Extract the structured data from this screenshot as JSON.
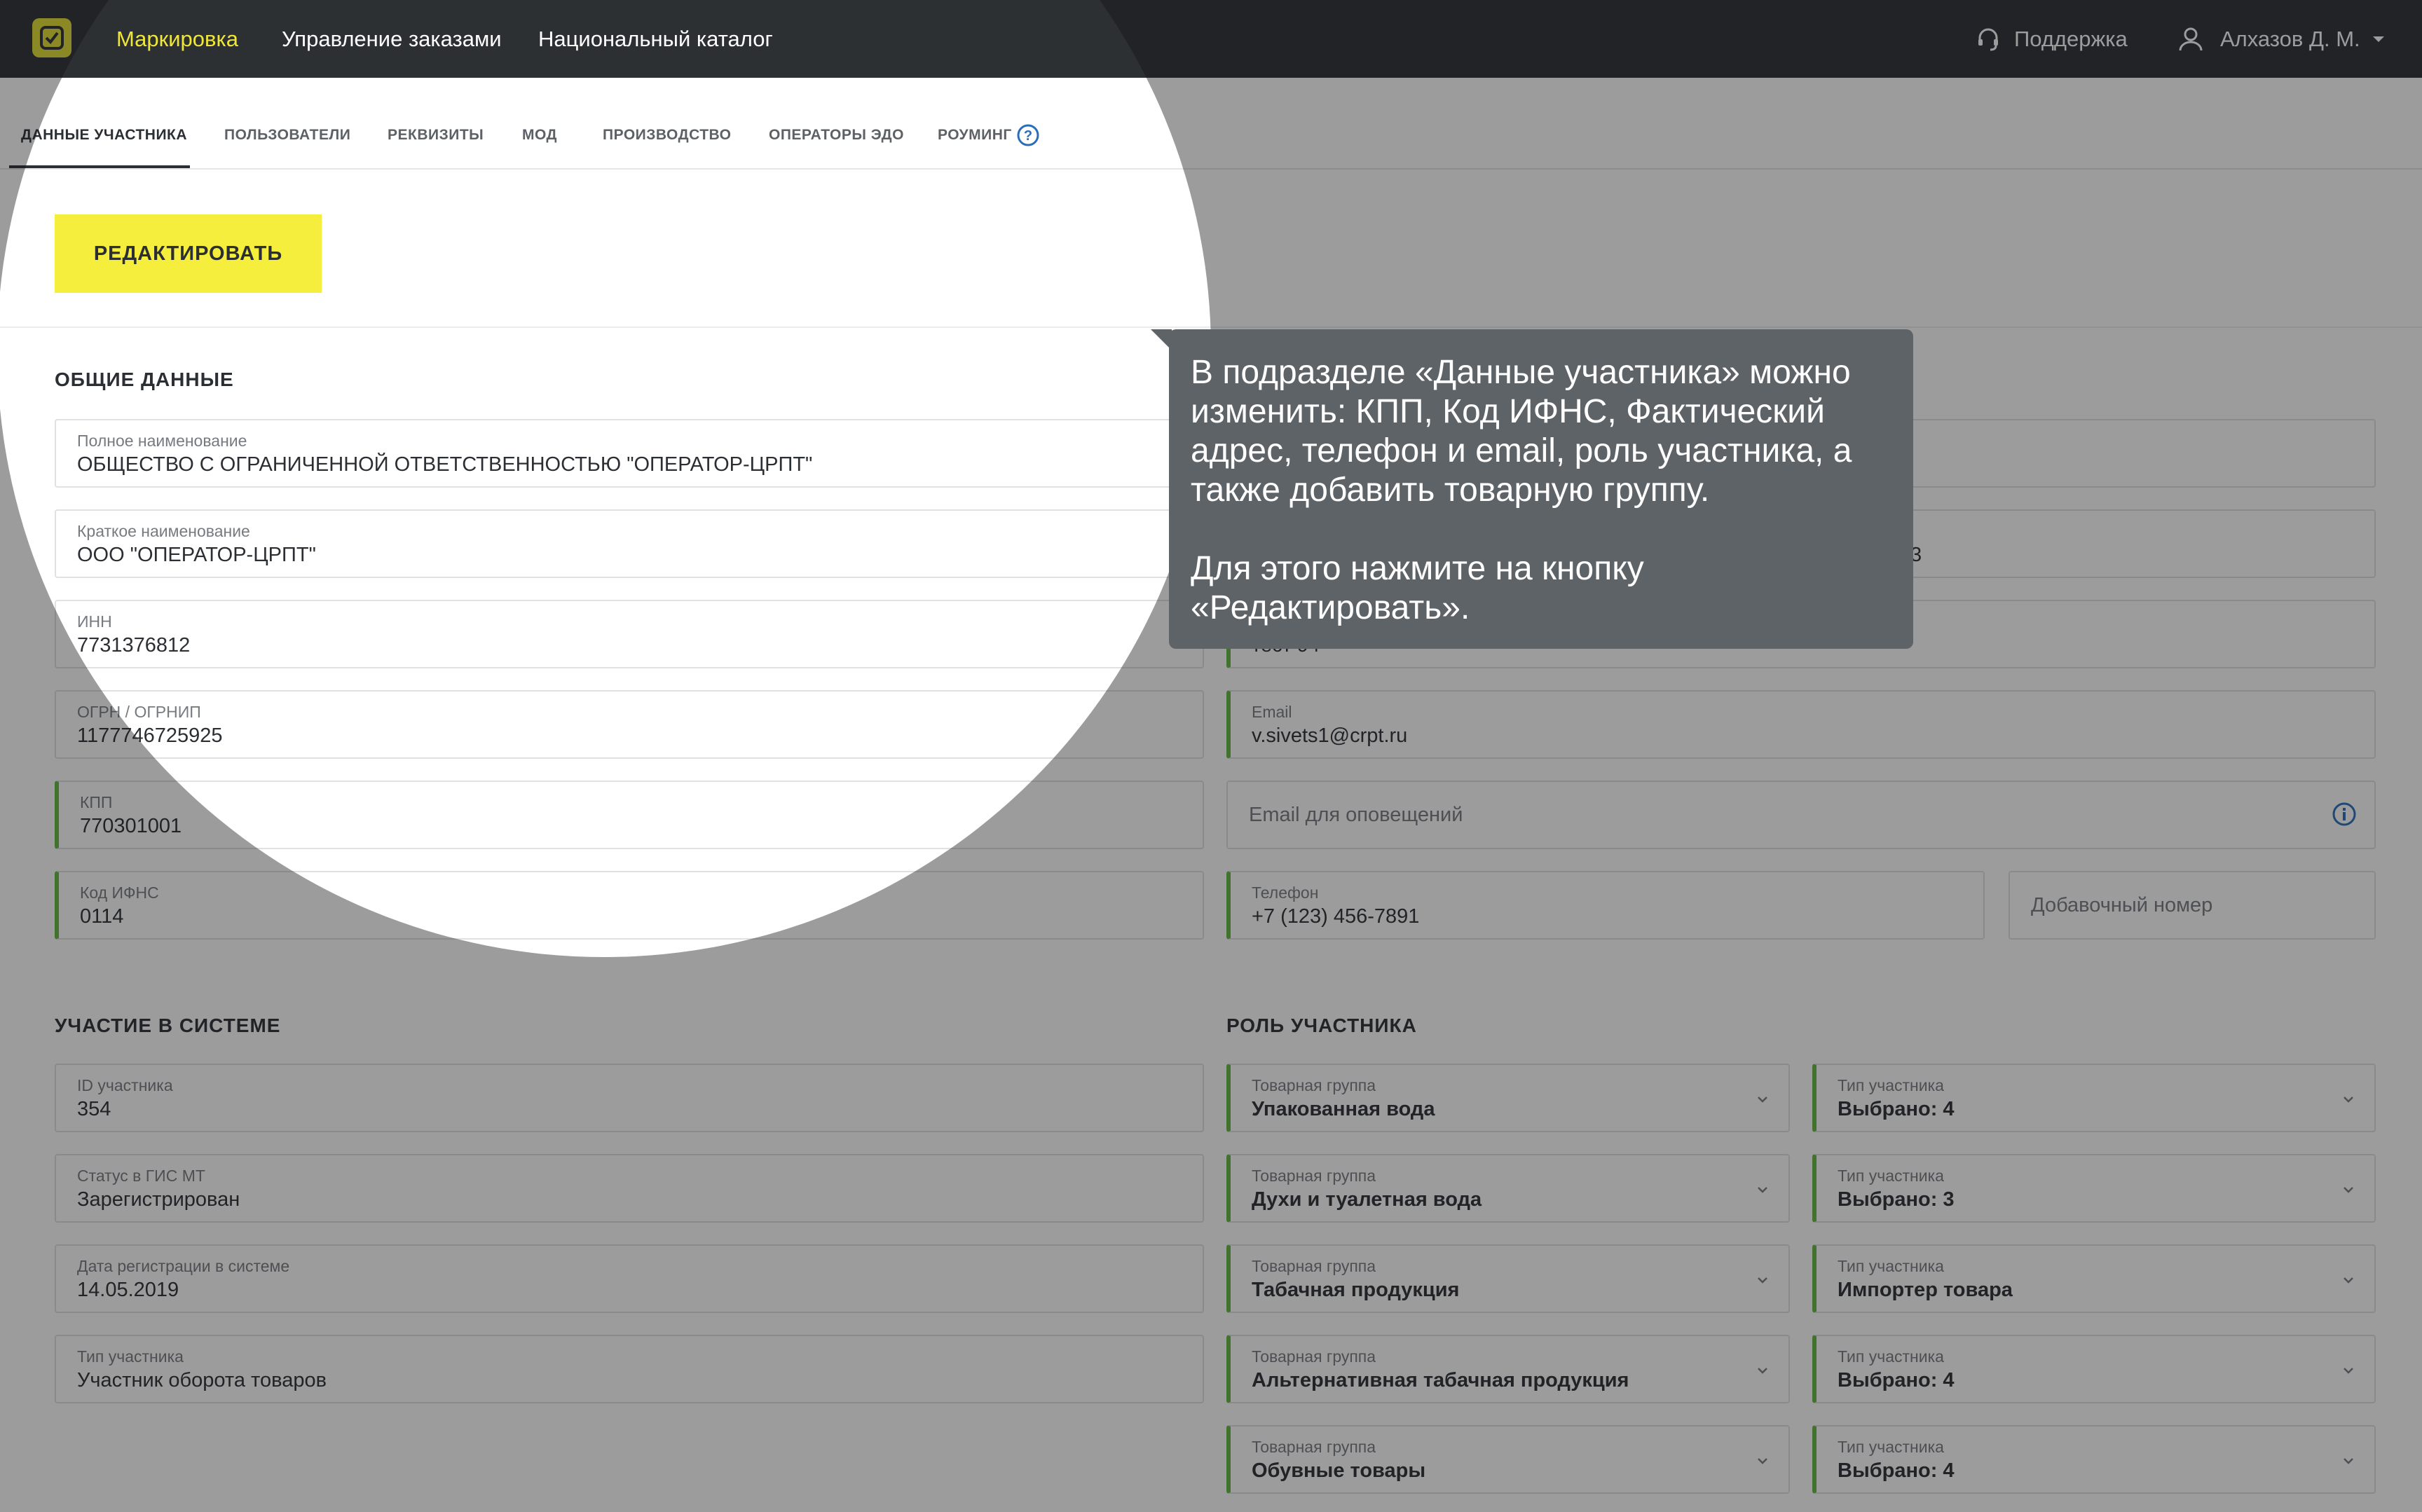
{
  "topnav": {
    "items": [
      "Маркировка",
      "Управление заказами",
      "Национальный каталог"
    ],
    "support": "Поддержка",
    "user": "Алхазов Д. М."
  },
  "tabs": [
    "Данные участника",
    "Пользователи",
    "Реквизиты",
    "МОД",
    "Производство",
    "Операторы ЭДО",
    "Роуминг"
  ],
  "edit_button": "РЕДАКТИРОВАТЬ",
  "general": {
    "title": "ОБЩИЕ ДАННЫЕ",
    "full_name": {
      "label": "Полное наименование",
      "value": "ОБЩЕСТВО С ОГРАНИЧЕННОЙ ОТВЕТСТВЕННОСТЬЮ \"ОПЕРАТОР-ЦРПТ\""
    },
    "short_name": {
      "label": "Краткое наименование",
      "value": "ООО \"ОПЕРАТОР-ЦРПТ\""
    },
    "inn": {
      "label": "ИНН",
      "value": "7731376812"
    },
    "ogrn": {
      "label": "ОГРН / ОГРНИП",
      "value": "1177746725925"
    },
    "kpp": {
      "label": "КПП",
      "value": "770301001"
    },
    "ifns": {
      "label": "Код ИФНС",
      "value": "0114"
    }
  },
  "contacts": {
    "right_row2_value": "м. 3",
    "right_row3_value": "тест 94",
    "email": {
      "label": "Email",
      "value": "v.sivets1@crpt.ru"
    },
    "notify_email_placeholder": "Email для оповещений",
    "phone": {
      "label": "Телефон",
      "value": "+7 (123) 456-7891"
    },
    "ext_placeholder": "Добавочный номер"
  },
  "system": {
    "title": "УЧАСТИЕ В СИСТЕМЕ",
    "id": {
      "label": "ID участника",
      "value": "354"
    },
    "status": {
      "label": "Статус в ГИС МТ",
      "value": "Зарегистрирован"
    },
    "reg_date": {
      "label": "Дата регистрации в системе",
      "value": "14.05.2019"
    },
    "type": {
      "label": "Тип участника",
      "value": "Участник оборота товаров"
    }
  },
  "roles": {
    "title": "РОЛЬ УЧАСТНИКА",
    "group_label": "Товарная группа",
    "type_label": "Тип участника",
    "rows": [
      {
        "group": "Упакованная вода",
        "type": "Выбрано: 4"
      },
      {
        "group": "Духи и туалетная вода",
        "type": "Выбрано: 3"
      },
      {
        "group": "Табачная продукция",
        "type": "Импортер товара"
      },
      {
        "group": "Альтернативная табачная продукция",
        "type": "Выбрано: 4"
      },
      {
        "group": "Обувные товары",
        "type": "Выбрано: 4"
      }
    ]
  },
  "tooltip": {
    "p1": "В подразделе «Данные участника» можно изменить: КПП, Код ИФНС, Фактический адрес, телефон и email, роль участника, а также добавить товарную группу.",
    "p2": "Для этого нажмите на кнопку «Редактировать»."
  },
  "colors": {
    "accent": "#f6ee3c",
    "nav_active": "#f0e63a",
    "green_edge": "#63b943",
    "topbar": "#2d3033",
    "info": "#2a6ebb"
  }
}
